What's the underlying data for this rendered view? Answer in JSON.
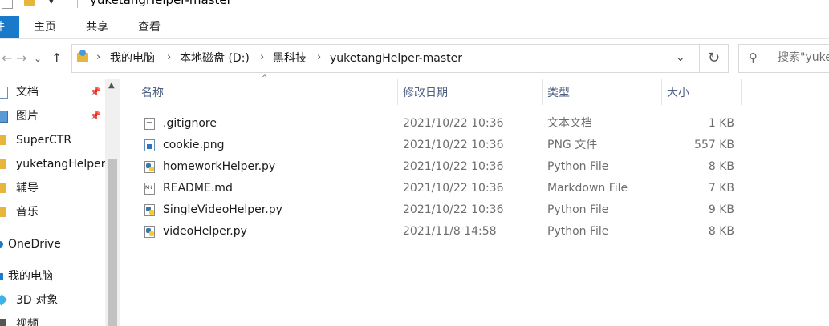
{
  "window": {
    "title": "yuketangHelper-master"
  },
  "ribbon": {
    "file_tab": "件",
    "tabs": [
      "主页",
      "共享",
      "查看"
    ]
  },
  "nav": {
    "back": "←",
    "forward": "→",
    "recent": "⌄",
    "up": "↑"
  },
  "address": {
    "crumbs": [
      "我的电脑",
      "本地磁盘 (D:)",
      "黑科技",
      "yuketangHelper-master"
    ],
    "separator": "›",
    "dropdown": "⌄",
    "refresh": "↻"
  },
  "search": {
    "placeholder": "搜索\"yuketangHelper-master\""
  },
  "sidebar": {
    "items": [
      {
        "label": "文档",
        "icon": "documents-icon",
        "pinned": true
      },
      {
        "label": "图片",
        "icon": "pictures-icon",
        "pinned": true
      },
      {
        "label": "SuperCTR",
        "icon": "folder-icon"
      },
      {
        "label": "yuketangHelper-master",
        "icon": "folder-icon"
      },
      {
        "label": "辅导",
        "icon": "folder-icon"
      },
      {
        "label": "音乐",
        "icon": "folder-icon"
      },
      {
        "label": "OneDrive",
        "icon": "onedrive-icon"
      },
      {
        "label": "我的电脑",
        "icon": "computer-icon"
      },
      {
        "label": "3D 对象",
        "icon": "3d-objects-icon"
      },
      {
        "label": "视频",
        "icon": "video-icon"
      }
    ],
    "pin_glyph": "📌"
  },
  "columns": {
    "name": "名称",
    "modified": "修改日期",
    "type": "类型",
    "size": "大小",
    "sort_glyph": "^"
  },
  "files": [
    {
      "name": ".gitignore",
      "modified": "2021/10/22 10:36",
      "type": "文本文档",
      "size": "1 KB",
      "icon": "text-file-icon"
    },
    {
      "name": "cookie.png",
      "modified": "2021/10/22 10:36",
      "type": "PNG 文件",
      "size": "557 KB",
      "icon": "image-file-icon"
    },
    {
      "name": "homeworkHelper.py",
      "modified": "2021/10/22 10:36",
      "type": "Python File",
      "size": "8 KB",
      "icon": "python-file-icon"
    },
    {
      "name": "README.md",
      "modified": "2021/10/22 10:36",
      "type": "Markdown File",
      "size": "7 KB",
      "icon": "markdown-file-icon"
    },
    {
      "name": "SingleVideoHelper.py",
      "modified": "2021/10/22 10:36",
      "type": "Python File",
      "size": "9 KB",
      "icon": "python-file-icon"
    },
    {
      "name": "videoHelper.py",
      "modified": "2021/11/8 14:58",
      "type": "Python File",
      "size": "8 KB",
      "icon": "python-file-icon"
    }
  ]
}
